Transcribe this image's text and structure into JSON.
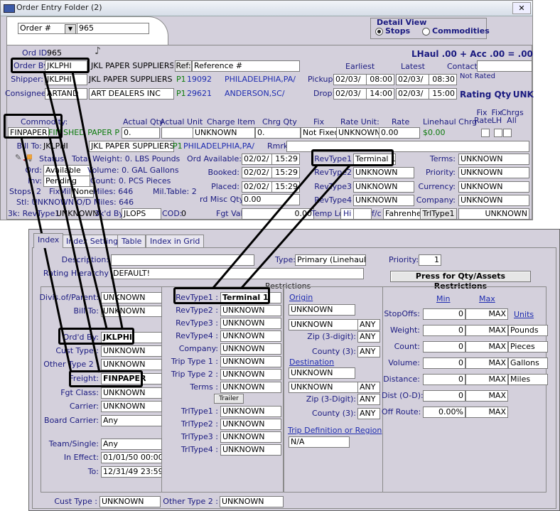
{
  "window": {
    "title": "Order Entry Folder (2)"
  },
  "top": {
    "order_selector": "Order #",
    "order_number": "965",
    "detail_view": {
      "label": "Detail View",
      "stops": "Stops",
      "commodities": "Commodities"
    },
    "ord_id_label": "Ord ID:",
    "ord_id_value": "965",
    "lhaul": "LHaul .00 + Acc .00 = .00",
    "order_by_label": "Order By:",
    "order_by_value": "JKLPHI",
    "order_by_name": "JKL PAPER SUPPLIERS",
    "ref_button": "Ref:",
    "ref_value": "Reference #",
    "earliest": "Earliest",
    "latest": "Latest",
    "contact_label": "Contact:",
    "shipper_label": "Shipper:",
    "shipper_value": "JKLPHI",
    "shipper_name": "JKL PAPER SUPPLIERS",
    "shipper_p1": "P1",
    "shipper_zip": "19092",
    "shipper_city": "PHILADELPHIA,PA/",
    "pickup_label": "Pickup:",
    "pickup_earliest_date": "02/03/",
    "pickup_earliest_time": "08:00",
    "pickup_latest_date": "02/03/",
    "pickup_latest_time": "08:30",
    "not_rated": "Not Rated",
    "consignee_label": "Consignee:",
    "consignee_value": "ARTAND",
    "consignee_name": "ART DEALERS INC",
    "consignee_p1": "P1",
    "consignee_zip": "29621",
    "consignee_city": "ANDERSON,SC/",
    "drop_label": "Drop:",
    "drop_earliest_date": "02/03/",
    "drop_earliest_time": "14:00",
    "drop_latest_date": "02/03/",
    "drop_latest_time": "15:00",
    "rating_qty": "Rating Qty",
    "unk": ". UNK",
    "commodity_label": "Commodity:",
    "commodity_value": "FINPAPER",
    "commodity_name": "FINISHED PAPER PF",
    "hdr_actual_qty": "Actual Qty",
    "hdr_actual_unit": "Actual Unit",
    "hdr_charge_item": "Charge Item",
    "hdr_chrg_qty": "Chrg Qty",
    "hdr_fix": "Fix",
    "hdr_rate_unit": "Rate Unit:",
    "hdr_rate": "Rate",
    "hdr_linehaul": "Linehaul Chrg",
    "hdr_fix_rate": "Fix Rate",
    "hdr_fix_lh": "Fix LH",
    "hdr_chrgs_all": "Chrgs All",
    "val_actual_qty": "0.",
    "val_charge_item": "UNKNOWN",
    "val_chrg_qty": "0.",
    "val_fix": "Not Fixed",
    "val_rate_unit": "UNKNOWN",
    "val_rate": "0.00",
    "val_linehaul": "$0.00",
    "bill_to_label": "Bill To:",
    "bill_to_value": "JKLPHI",
    "bill_to_name": "JKL PAPER SUPPLIERS",
    "bill_to_p1": "P1",
    "bill_to_city": "PHILADELPHIA,PA/",
    "rmrk_label": "Rmrk:",
    "status_label": "Status",
    "total_weight": "Total Weight: 0. LBS Pounds",
    "ord_status_label": "Ord:",
    "ord_status_value": "Available",
    "volume": "Volume: 0. GAL Gallons",
    "inv_label": "Inv:",
    "inv_value": "Pending",
    "count": "Count: 0. PCS Pieces",
    "stops": "Stops: 2",
    "fixmile_label": "FixMile",
    "fixmile_value": "None",
    "miles": "Miles: 646",
    "mil_table": "Mil.Table: 2",
    "stl": "Stl: UNKNOWN O/D Miles: 646",
    "rk_revtype": "3k: RevType1",
    "rk_revtype_value": "UNKNOWN",
    "bkd_by": "3k'd By:",
    "bkd_by_value": "JLOPS",
    "cod": "COD:",
    "cod_value": "0",
    "ord_available_label": "Ord Available:",
    "ord_available_date": "02/02/",
    "ord_available_time": "15:29",
    "booked_label": "Booked:",
    "booked_date": "02/02/",
    "booked_time": "15:29",
    "placed_label": "Placed:",
    "placed_date": "02/02/",
    "placed_time": "15:29",
    "misc_qty_label": "rd Misc Qty 1",
    "misc_qty_value": "0.00",
    "fgt_val_label": "Fgt Val:",
    "fgt_val_value": "0.00",
    "temp_lo": "Temp Lo",
    "hi": "Hi",
    "fc": "f/c",
    "fahrenheit": "Fahrenheit",
    "trltype1_btn": "TrlType1",
    "trltype1_value": "UNKNOWN",
    "revtype1_label": "RevType1",
    "revtype1_value": "Terminal 1",
    "revtype2_label": "RevType2",
    "revtype2_value": "UNKNOWN",
    "revtype3_label": "RevType3",
    "revtype3_value": "UNKNOWN",
    "revtype4_label": "RevType4",
    "revtype4_value": "UNKNOWN",
    "terms_label": "Terms:",
    "terms_value": "UNKNOWN",
    "priority_label": "Priority:",
    "priority_value": "UNKNOWN",
    "currency_label": "Currency:",
    "currency_value": "UNKNOWN",
    "company_label": "Company:",
    "company_value": "UNKNOWN"
  },
  "bottom": {
    "tabs": [
      "Index",
      "Index Settings",
      "Table",
      "Index in Grid"
    ],
    "description_label": "Description:",
    "type_label": "Type:",
    "type_value": "Primary (Linehaul)",
    "priority_label": "Priority:",
    "priority_value": "1",
    "rating_hierarchy_label": "Rating Hierarchy",
    "rating_hierarchy_value": "DEFAULT!",
    "press_button": "Press for Qty/Assets Restrictions",
    "restrictions": "Restrictions",
    "left": [
      {
        "label": "Divis.of/Parent:",
        "value": "UNKNOWN"
      },
      {
        "label": "Bill To:",
        "value": "UNKNOWN"
      },
      {
        "label": "Ord'd By:",
        "value": "JKLPHI"
      },
      {
        "label": "Cust Type :",
        "value": "UNKNOWN"
      },
      {
        "label": "Other Type 2 :",
        "value": "UNKNOWN"
      },
      {
        "label": "Freight:",
        "value": "FINPAPER"
      },
      {
        "label": "Fgt Class:",
        "value": "UNKNOWN"
      },
      {
        "label": "Carrier:",
        "value": "UNKNOWN"
      },
      {
        "label": "Board Carrier:",
        "value": "Any"
      },
      {
        "label": "Team/Single:",
        "value": "Any"
      },
      {
        "label": "In Effect:",
        "value": "01/01/50 00:00"
      },
      {
        "label": "To:",
        "value": "12/31/49 23:59"
      }
    ],
    "mid": [
      {
        "label": "RevType1 :",
        "value": "Terminal 1"
      },
      {
        "label": "RevType2 :",
        "value": "UNKNOWN"
      },
      {
        "label": "RevType3 :",
        "value": "UNKNOWN"
      },
      {
        "label": "RevType4 :",
        "value": "UNKNOWN"
      },
      {
        "label": "Company:",
        "value": "UNKNOWN"
      },
      {
        "label": "Trip Type 1 :",
        "value": "UNKNOWN"
      },
      {
        "label": "Trip Type 2 :",
        "value": "UNKNOWN"
      },
      {
        "label": "Terms :",
        "value": "UNKNOWN"
      }
    ],
    "trailer_btn": "Trailer",
    "trl": [
      {
        "label": "TrlType1 :",
        "value": "UNKNOWN"
      },
      {
        "label": "TrlType2 :",
        "value": "UNKNOWN"
      },
      {
        "label": "TrlType3 :",
        "value": "UNKNOWN"
      },
      {
        "label": "TrlType4 :",
        "value": "UNKNOWN"
      }
    ],
    "origin_label": "Origin",
    "origin_value": "UNKNOWN",
    "origin_value2": "UNKNOWN",
    "origin_any": "ANY",
    "zip3_label": "Zip (3-digit):",
    "zip3_value": "ANY",
    "county_label": "County (3):",
    "county_value": "ANY",
    "destination_label": "Destination",
    "dest_value": "UNKNOWN",
    "dest_value2": "UNKNOWN",
    "dest_any": "ANY",
    "dzip3_label": "Zip (3-Digit):",
    "dzip3_value": "ANY",
    "dcounty_label": "County (3):",
    "dcounty_value": "ANY",
    "trip_def_label": "Trip Definition or Region",
    "trip_def_value": "N/A",
    "min_label": "Min",
    "max_label": "Max",
    "units_label": "Units",
    "qty": [
      {
        "label": "StopOffs:",
        "min": "0",
        "max": "MAX",
        "unit": ""
      },
      {
        "label": "Weight:",
        "min": "0",
        "max": "MAX",
        "unit": "Pounds"
      },
      {
        "label": "Count:",
        "min": "0",
        "max": "MAX",
        "unit": "Pieces"
      },
      {
        "label": "Volume:",
        "min": "0",
        "max": "MAX",
        "unit": "Gallons"
      },
      {
        "label": "Distance:",
        "min": "0",
        "max": "MAX",
        "unit": "Miles"
      },
      {
        "label": "Dist (O-D):",
        "min": "0",
        "max": "MAX",
        "unit": ""
      },
      {
        "label": "Off Route:",
        "min": "0.00%",
        "max": "MAX",
        "unit": ""
      }
    ],
    "cust_type_label": "Cust Type :",
    "cust_type_value": "UNKNOWN",
    "other_type2_label": "Other Type 2 :",
    "other_type2_value": "UNKNOWN"
  }
}
